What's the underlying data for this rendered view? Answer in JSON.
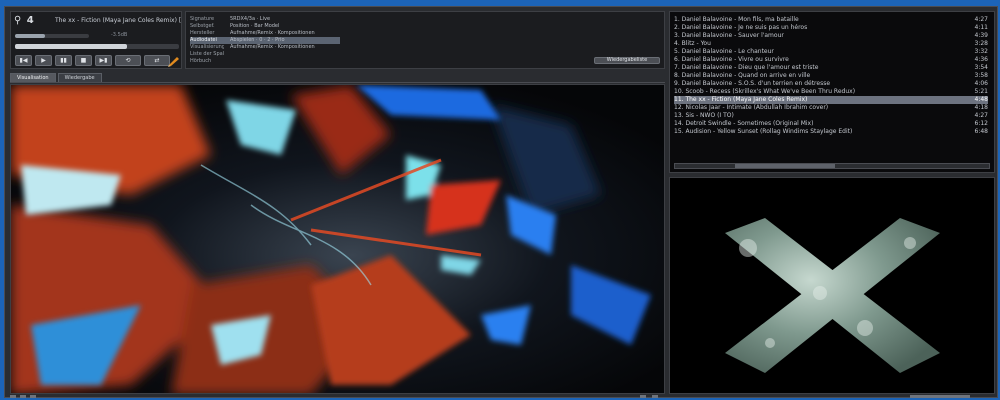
{
  "player": {
    "logo_text": "⚲ 4",
    "now_playing": "The xx - Fiction (Maya Jane Coles Remix) [6",
    "volume_fraction": 0.4,
    "seek_fraction": 0.68,
    "volume_caption": "-3.5dB",
    "controls": [
      "▮◀",
      "▶",
      "▮▮",
      "■",
      "▶▮",
      "⟲",
      "⇄"
    ],
    "icons": [
      "prev-icon",
      "play-icon",
      "pause-icon",
      "stop-icon",
      "next-icon",
      "repeat-icon",
      "shuffle-icon"
    ]
  },
  "info": {
    "rows": [
      {
        "k": "Signature",
        "v": "5RDX4/3a · Live"
      },
      {
        "k": "Selbstgef.",
        "v": "Position · Bar Model"
      },
      {
        "k": "Hersteller",
        "v": "Aufnahme/Remix · Kompositionen"
      },
      {
        "k": "Audiodatei",
        "v": "Abspielen · 0 · 2 · Prio"
      },
      {
        "k": "Visualisierung",
        "v": "Aufnahme/Remix · Kompositionen"
      },
      {
        "k": "Liste der Spalten",
        "v": ""
      },
      {
        "k": "Hörbuch",
        "v": ""
      }
    ],
    "selected_index": 3,
    "right_button": "Wiedergabeliste"
  },
  "tabs": [
    {
      "label": "Visualisation",
      "active": true
    },
    {
      "label": "Wiedergabe",
      "active": false
    }
  ],
  "playlist": {
    "current_index": 10,
    "items": [
      {
        "title": "1. Daniel Balavoine - Mon fils, ma bataille",
        "dur": "4:27"
      },
      {
        "title": "2. Daniel Balavoine - Je ne suis pas un héros",
        "dur": "4:11"
      },
      {
        "title": "3. Daniel Balavoine - Sauver l'amour",
        "dur": "4:39"
      },
      {
        "title": "4. Blitz - You",
        "dur": "3:28"
      },
      {
        "title": "5. Daniel Balavoine - Le chanteur",
        "dur": "3:32"
      },
      {
        "title": "6. Daniel Balavoine - Vivre ou survivre",
        "dur": "4:36"
      },
      {
        "title": "7. Daniel Balavoine - Dieu que l'amour est triste",
        "dur": "3:54"
      },
      {
        "title": "8. Daniel Balavoine - Quand on arrive en ville",
        "dur": "3:58"
      },
      {
        "title": "9. Daniel Balavoine - S.O.S. d'un terrien en détresse",
        "dur": "4:06"
      },
      {
        "title": "10. Scoob - Recess (Skrillex's What We've Been Thru Redux)",
        "dur": "5:21"
      },
      {
        "title": "11. The xx - Fiction (Maya Jane Coles Remix)",
        "dur": "4:48"
      },
      {
        "title": "12. Nicolas Jaar - Intimate (Abdullah Ibrahim cover)",
        "dur": "4:18"
      },
      {
        "title": "13. Sis - NWO (I TO)",
        "dur": "4:27"
      },
      {
        "title": "14. Detroit Swindle - Sometimes (Original Mix)",
        "dur": "6:12"
      },
      {
        "title": "15. Audision - Yellow Sunset (Rollag Windims Staylage Edit)",
        "dur": "6:48"
      }
    ]
  },
  "colors": {
    "accent": "#6d7380",
    "panel": "#1b1c1f",
    "frame": "#1c64b8"
  }
}
